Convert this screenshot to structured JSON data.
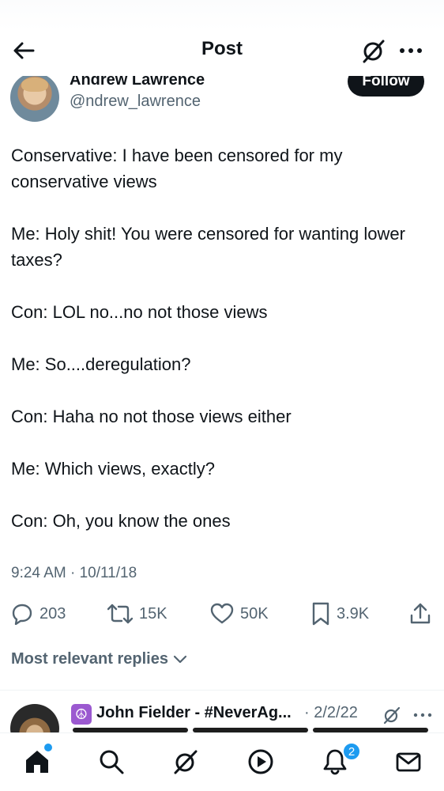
{
  "header": {
    "title": "Post",
    "back_icon": "back-arrow-icon",
    "grok_icon": "grok-icon",
    "more_icon": "more-options-icon"
  },
  "author": {
    "name": "Andrew Lawrence",
    "handle": "@ndrew_lawrence",
    "follow_label": "Follow"
  },
  "tweet": {
    "paragraphs": [
      "Conservative: I have been censored for my conservative views",
      "Me: Holy shit! You were censored for wanting lower taxes?",
      "Con: LOL no...no not those views",
      "Me: So....deregulation?",
      "Con: Haha no not those views either",
      "Me: Which views, exactly?",
      "Con: Oh, you know the ones"
    ],
    "timestamp": "9:24 AM · 10/11/18"
  },
  "actions": {
    "replies": "203",
    "reposts": "15K",
    "likes": "50K",
    "bookmarks": "3.9K"
  },
  "replies_sort_label": "Most relevant replies",
  "reply": {
    "badge": "☮",
    "name": "John Fielder - #NeverAg...",
    "date": "· 2/2/22"
  },
  "bottom_nav": {
    "items": [
      "home-icon",
      "search-icon",
      "grok-icon",
      "video-icon",
      "notifications-icon",
      "messages-icon"
    ],
    "notification_count": "2"
  },
  "colors": {
    "text": "#0f1419",
    "secondary": "#536471",
    "accent": "#1d9bf0"
  }
}
